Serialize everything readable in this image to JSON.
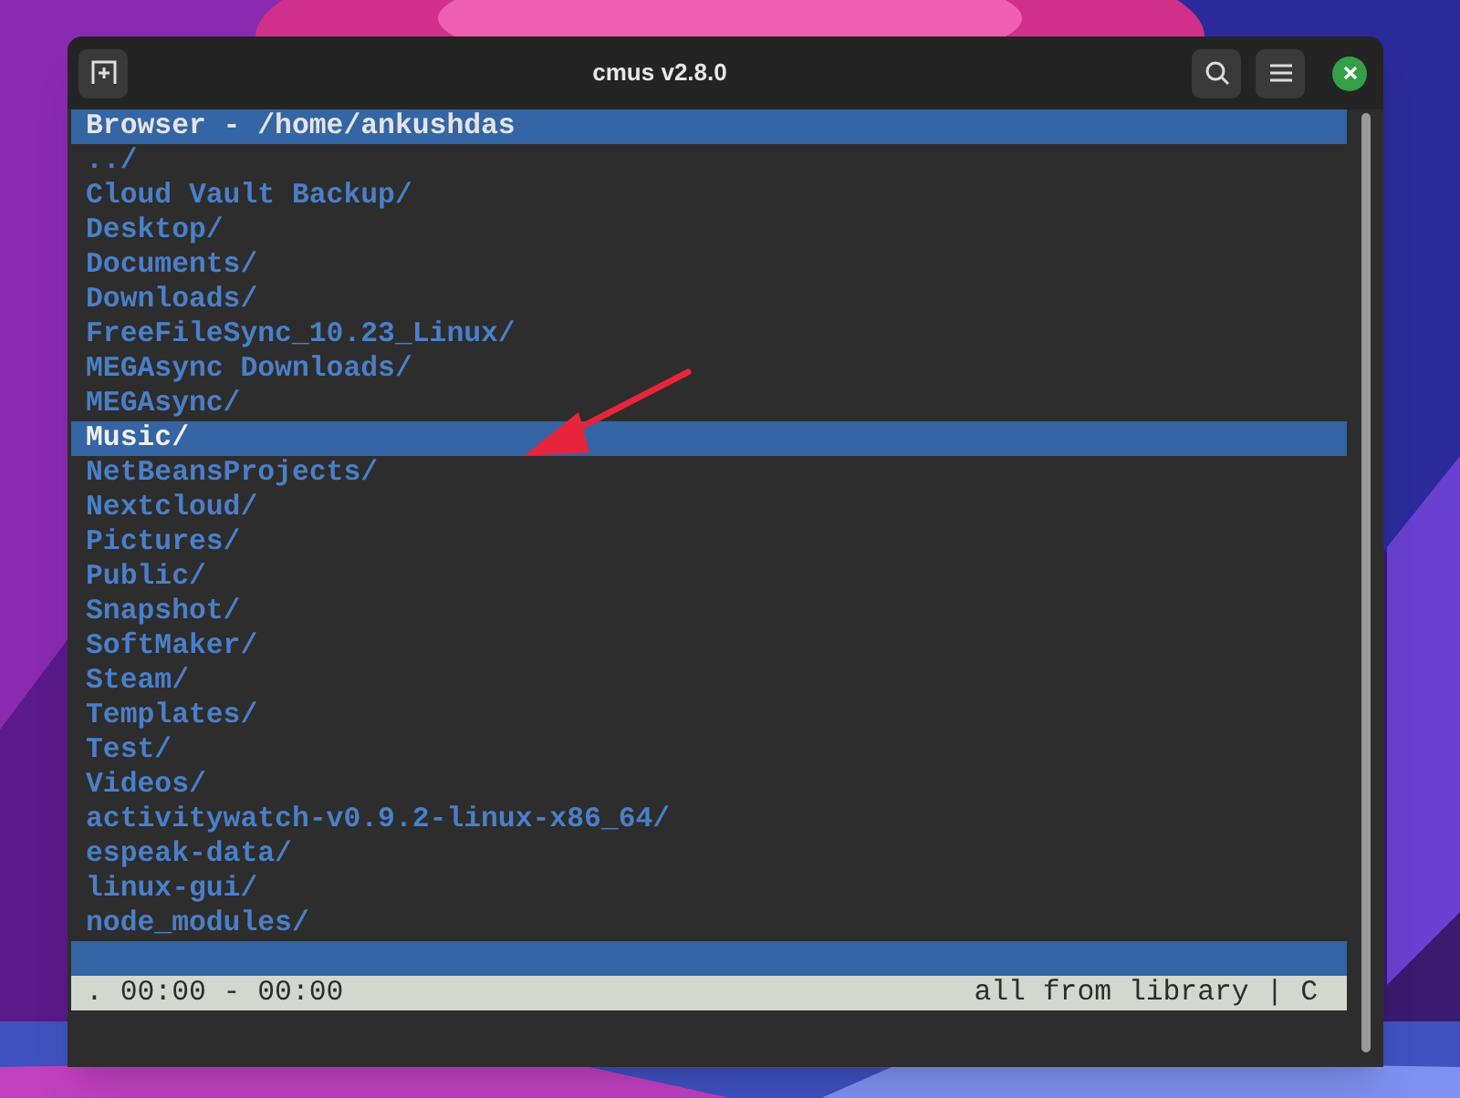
{
  "window": {
    "title": "cmus v2.8.0"
  },
  "browser": {
    "title": "Browser - /home/ankushdas",
    "items": [
      {
        "label": "../",
        "selected": false
      },
      {
        "label": "Cloud Vault Backup/",
        "selected": false
      },
      {
        "label": "Desktop/",
        "selected": false
      },
      {
        "label": "Documents/",
        "selected": false
      },
      {
        "label": "Downloads/",
        "selected": false
      },
      {
        "label": "FreeFileSync_10.23_Linux/",
        "selected": false
      },
      {
        "label": "MEGAsync Downloads/",
        "selected": false
      },
      {
        "label": "MEGAsync/",
        "selected": false
      },
      {
        "label": "Music/",
        "selected": true
      },
      {
        "label": "NetBeansProjects/",
        "selected": false
      },
      {
        "label": "Nextcloud/",
        "selected": false
      },
      {
        "label": "Pictures/",
        "selected": false
      },
      {
        "label": "Public/",
        "selected": false
      },
      {
        "label": "Snapshot/",
        "selected": false
      },
      {
        "label": "SoftMaker/",
        "selected": false
      },
      {
        "label": "Steam/",
        "selected": false
      },
      {
        "label": "Templates/",
        "selected": false
      },
      {
        "label": "Test/",
        "selected": false
      },
      {
        "label": "Videos/",
        "selected": false
      },
      {
        "label": "activitywatch-v0.9.2-linux-x86_64/",
        "selected": false
      },
      {
        "label": "espeak-data/",
        "selected": false
      },
      {
        "label": "linux-gui/",
        "selected": false
      },
      {
        "label": "node_modules/",
        "selected": false
      }
    ]
  },
  "status_bar": {
    "position": ". 00:00 - 00:00",
    "mode": "all from library | C"
  }
}
